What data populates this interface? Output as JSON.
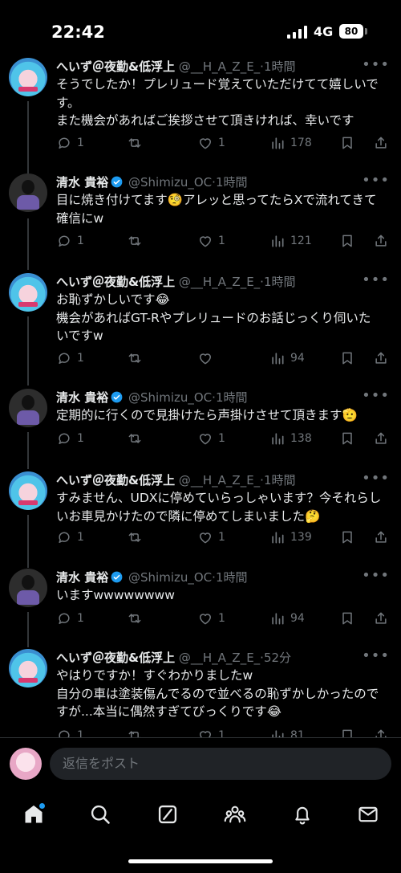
{
  "status_bar": {
    "time": "22:42",
    "network": "4G",
    "battery": "80"
  },
  "tweets": [
    {
      "author": "haze",
      "name": "へいず＠夜勤&低浮上",
      "handle": "@__H_A_Z_E_",
      "time": "1時間",
      "lines": [
        "そうでしたか！プレリュード覚えていただけてて嬉しいで",
        "す。",
        "また機会があればご挨拶させて頂きければ、幸いです"
      ],
      "replies": "1",
      "retweets": "",
      "likes": "1",
      "views": "178"
    },
    {
      "author": "shimizu",
      "name": "清水 貴裕",
      "handle": "@Shimizu_OC",
      "time": "1時間",
      "lines": [
        "目に焼き付けてます🧐アレッと思ってたらXで流れてきて",
        "確信にw"
      ],
      "replies": "1",
      "retweets": "",
      "likes": "1",
      "views": "121"
    },
    {
      "author": "haze",
      "name": "へいず＠夜勤&低浮上",
      "handle": "@__H_A_Z_E_",
      "time": "1時間",
      "lines": [
        "お恥ずかしいです😂",
        "機会があればGT-Rやプレリュードのお話じっくり伺いた",
        "いですw"
      ],
      "replies": "1",
      "retweets": "",
      "likes": "",
      "views": "94"
    },
    {
      "author": "shimizu",
      "name": "清水 貴裕",
      "handle": "@Shimizu_OC",
      "time": "1時間",
      "lines": [
        "定期的に行くので見掛けたら声掛けさせて頂きます🫡"
      ],
      "replies": "1",
      "retweets": "",
      "likes": "1",
      "views": "138"
    },
    {
      "author": "haze",
      "name": "へいず＠夜勤&低浮上",
      "handle": "@__H_A_Z_E_",
      "time": "1時間",
      "lines": [
        "すみません、UDXに停めていらっしゃいます？今それらし",
        "いお車見かけたので隣に停めてしまいました🤔"
      ],
      "replies": "1",
      "retweets": "",
      "likes": "1",
      "views": "139"
    },
    {
      "author": "shimizu",
      "name": "清水 貴裕",
      "handle": "@Shimizu_OC",
      "time": "1時間",
      "lines": [
        "いますwwwwwwww"
      ],
      "replies": "1",
      "retweets": "",
      "likes": "1",
      "views": "94"
    },
    {
      "author": "haze",
      "name": "へいず＠夜勤&低浮上",
      "handle": "@__H_A_Z_E_",
      "time": "52分",
      "lines": [
        "やはりですか！すぐわかりましたw",
        "自分の車は塗装傷んでるので並べるの恥ずかしかったので",
        "すが...本当に偶然すぎてびっくりです😂"
      ],
      "replies": "1",
      "retweets": "",
      "likes": "1",
      "views": "81"
    }
  ],
  "reply_bar": {
    "placeholder": "返信をポスト"
  },
  "nav": {
    "items": [
      "home-icon",
      "search-icon",
      "grok-icon",
      "communities-icon",
      "notifications-icon",
      "messages-icon"
    ],
    "home_badge": true
  },
  "colors": {
    "background": "#000000",
    "text": "#e7e9ea",
    "muted": "#71767b",
    "accent": "#1d9bf0"
  }
}
